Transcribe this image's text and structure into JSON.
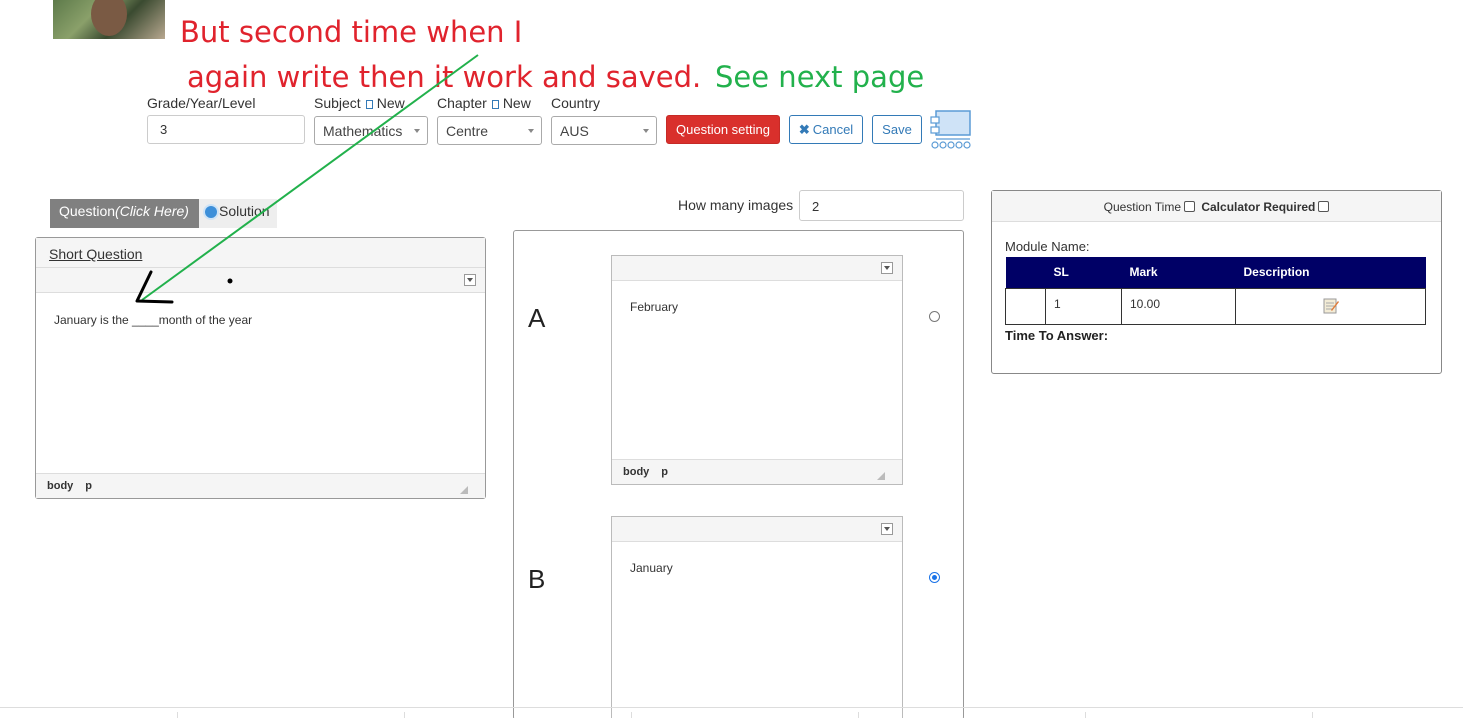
{
  "annotation": {
    "line1": "But second time when I",
    "line2": "again write then it work and saved.",
    "line2_green": "See next page",
    "red_color": "#e0232d",
    "green_color": "#22b14c"
  },
  "filters": {
    "grade_label": "Grade/Year/Level",
    "grade_value": "3",
    "subject_label": "Subject",
    "subject_new": "New",
    "subject_value": "Mathematics",
    "chapter_label": "Chapter",
    "chapter_new": "New",
    "chapter_value": "Centre",
    "country_label": "Country",
    "country_value": "AUS"
  },
  "toolbar": {
    "question_setting": "Question setting",
    "cancel": "Cancel",
    "save": "Save"
  },
  "tabs": {
    "question": "Question",
    "question_hint": "(Click Here)",
    "solution": "Solution"
  },
  "question_panel": {
    "title": "Short Question",
    "body": "January is the ____month of the year",
    "status": [
      "body",
      "p"
    ]
  },
  "options": {
    "how_many_label": "How many images",
    "how_many_value": "2",
    "items": [
      {
        "letter": "A",
        "text": "February",
        "selected": false
      },
      {
        "letter": "B",
        "text": "January",
        "selected": true
      }
    ],
    "status": [
      "body",
      "p"
    ]
  },
  "side_panel": {
    "question_time": "Question Time",
    "calculator": "Calculator Required",
    "module_name": "Module Name:",
    "columns": [
      "SL",
      "Mark",
      "Description"
    ],
    "rows": [
      {
        "sl": "1",
        "mark": "10.00"
      }
    ],
    "time_to_answer": "Time To Answer:"
  },
  "colors": {
    "accent_blue": "#337ab7",
    "danger_red": "#d9302c",
    "table_header": "#000066"
  }
}
